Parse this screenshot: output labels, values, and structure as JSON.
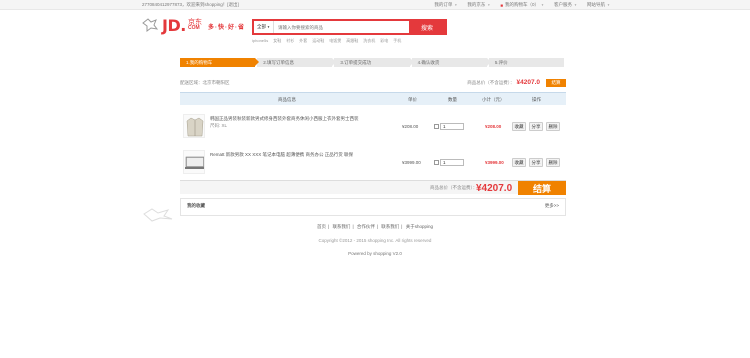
{
  "topbar": {
    "welcome": "2770840412977873，欢迎来到shopping！[退出]",
    "links": [
      "我的订单",
      "我的京东",
      "我的购物车（0）",
      "客户服务",
      "网站导航"
    ]
  },
  "logo": {
    "text": "JD.",
    "cn": "京东",
    "com": "COM",
    "slogan": "多·快·好·省"
  },
  "search": {
    "category": "全部",
    "placeholder": "请输入你要搜索的商品",
    "button": "搜索",
    "hotwords": [
      "iphone5s",
      "女鞋",
      "衬衫",
      "外套",
      "运动鞋",
      "电饭煲",
      "高跟鞋",
      "洗衣机",
      "彩电",
      "手机"
    ]
  },
  "steps": [
    "1.我的购物车",
    "2.填写订单信息",
    "3.订单提交成功",
    "4.确认收货",
    "5.评价"
  ],
  "cart": {
    "address": "配送区域：北京市朝阳区",
    "summary_label": "商品总价（不含运费）：",
    "summary_amount": "¥4207.0",
    "summary_button": "结算",
    "headers": {
      "product": "商品信息",
      "price": "单价",
      "qty": "数量",
      "subtotal": "小计（元）",
      "ops": "操作"
    },
    "items": [
      {
        "name": "韩国正品男装秋装新款男式修身西装外套商务休闲小西服上衣外套男士西装",
        "spec": "尺码: XL",
        "price": "¥208.00",
        "qty": "1",
        "subtotal": "¥208.00",
        "op1": "收藏",
        "op2": "分享",
        "op3": "删除"
      },
      {
        "name": "Rematt 新款男款 XX XXX 笔记本电脑 超薄便携 商务办公 正品行货 联保",
        "spec": "",
        "price": "¥3999.00",
        "qty": "1",
        "subtotal": "¥3999.00",
        "op1": "收藏",
        "op2": "分享",
        "op3": "删除"
      }
    ],
    "total_label": "商品总价（不含运费）：",
    "total_amount": "¥4207.0",
    "checkout": "结算"
  },
  "recent": {
    "title": "我的收藏",
    "more": "更多>>"
  },
  "footer": {
    "links": [
      "首页",
      "联系我们",
      "合作伙伴",
      "联系我们",
      "关于shopping"
    ],
    "copy": "Copyright ©2012 - 2015 shopping Inc. All rights reserved",
    "power": "Powered by shopping V2.0"
  },
  "colors": {
    "brand": "#e4393c",
    "accent": "#f08200"
  }
}
